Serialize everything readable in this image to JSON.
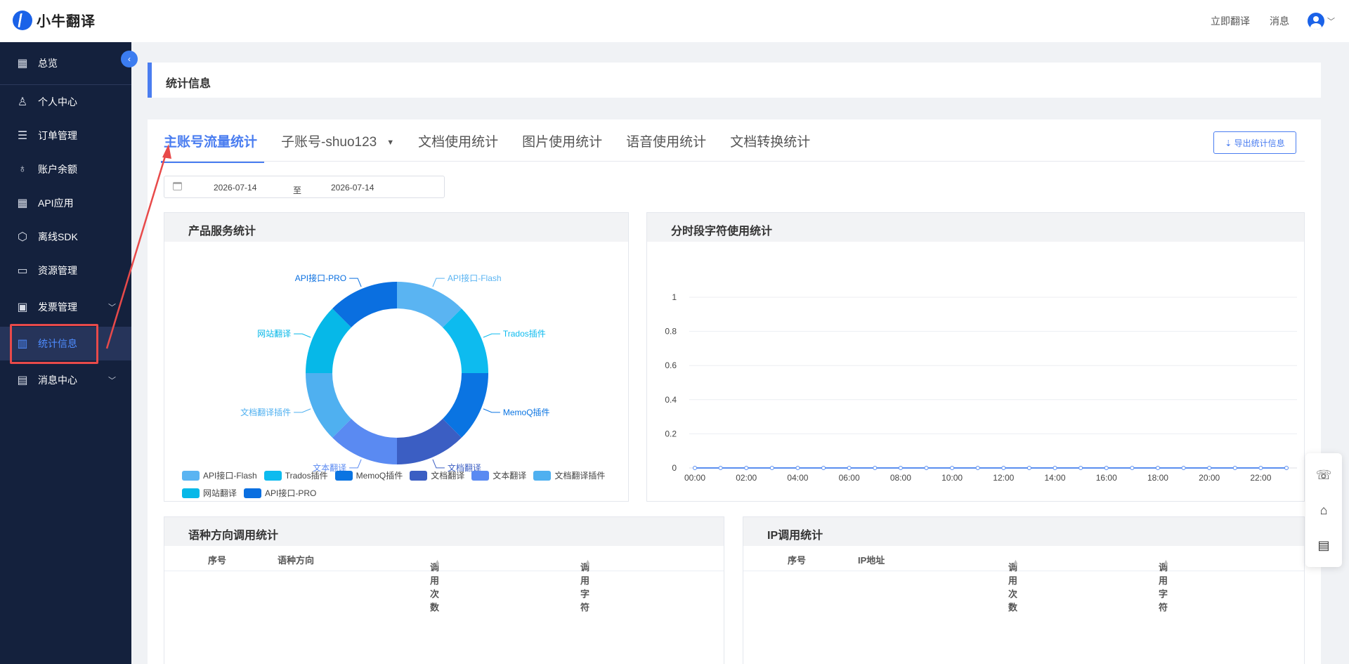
{
  "header": {
    "logo_text": "小牛翻译",
    "links": [
      "立即翻译",
      "消息"
    ],
    "avatar_caret": "﹀"
  },
  "sidebar": {
    "items": [
      {
        "label": "总览",
        "icon": "grid-icon",
        "glyph": "▦"
      },
      {
        "label": "个人中心",
        "icon": "user-icon",
        "glyph": "♙"
      },
      {
        "label": "订单管理",
        "icon": "order-icon",
        "glyph": "☰"
      },
      {
        "label": "账户余额",
        "icon": "wallet-icon",
        "glyph": "♁"
      },
      {
        "label": "API应用",
        "icon": "apps-icon",
        "glyph": "▦"
      },
      {
        "label": "离线SDK",
        "icon": "cube-icon",
        "glyph": "⬡"
      },
      {
        "label": "资源管理",
        "icon": "folder-icon",
        "glyph": "▭"
      },
      {
        "label": "发票管理",
        "icon": "invoice-icon",
        "glyph": "▣"
      },
      {
        "label": "统计信息",
        "icon": "chart-icon",
        "glyph": "▥"
      },
      {
        "label": "消息中心",
        "icon": "message-icon",
        "glyph": "▤"
      }
    ],
    "active_index": 8
  },
  "page": {
    "title": "统计信息"
  },
  "tabs": [
    {
      "label": "主账号流量统计"
    },
    {
      "label": "子账号-shuo123",
      "dropdown": true
    },
    {
      "label": "文档使用统计"
    },
    {
      "label": "图片使用统计"
    },
    {
      "label": "语音使用统计"
    },
    {
      "label": "文档转换统计"
    }
  ],
  "export_label": "⇣ 导出统计信息",
  "date_range": {
    "start": "2026-07-14",
    "separator": "至",
    "end": "2026-07-14"
  },
  "product_card": {
    "title": "产品服务统计"
  },
  "hourly_card": {
    "title": "分时段字符使用统计"
  },
  "lang_card": {
    "title": "语种方向调用统计",
    "columns": [
      "序号",
      "语种方向",
      "调用次数",
      "调用字符"
    ]
  },
  "ip_card": {
    "title": "IP调用统计",
    "columns": [
      "序号",
      "IP地址",
      "调用次数",
      "调用字符"
    ]
  },
  "colors": {
    "accent": "#4a7df0",
    "sidebar_bg": "#14213d",
    "highlight": "#e84a4a"
  },
  "chart_data": [
    {
      "type": "pie",
      "style": "donut",
      "labels": [
        "API接口-Flash",
        "Trados插件",
        "MemoQ插件",
        "文档翻译",
        "文本翻译",
        "文档翻译插件",
        "网站翻译",
        "API接口-PRO"
      ],
      "values": [
        1,
        1,
        1,
        1,
        1,
        1,
        1,
        1
      ],
      "colors": [
        "#5ab4f2",
        "#0dbbef",
        "#0a74e2",
        "#3b5ec3",
        "#5a8af2",
        "#4fb0f0",
        "#06b8e8",
        "#0a6fe0"
      ],
      "legend_position": "bottom"
    },
    {
      "type": "line",
      "x": [
        "00:00",
        "01:00",
        "02:00",
        "03:00",
        "04:00",
        "05:00",
        "06:00",
        "07:00",
        "08:00",
        "09:00",
        "10:00",
        "11:00",
        "12:00",
        "13:00",
        "14:00",
        "15:00",
        "16:00",
        "17:00",
        "18:00",
        "19:00",
        "20:00",
        "21:00",
        "22:00",
        "23:00"
      ],
      "x_tick_labels": [
        "00:00",
        "02:00",
        "04:00",
        "06:00",
        "08:00",
        "10:00",
        "12:00",
        "14:00",
        "16:00",
        "18:00",
        "20:00",
        "22:00"
      ],
      "series": [
        {
          "values": [
            0,
            0,
            0,
            0,
            0,
            0,
            0,
            0,
            0,
            0,
            0,
            0,
            0,
            0,
            0,
            0,
            0,
            0,
            0,
            0,
            0,
            0,
            0,
            0
          ]
        }
      ],
      "ylim": [
        0,
        1
      ],
      "y_ticks": [
        "0",
        "0.2",
        "0.4",
        "0.6",
        "0.8",
        "1"
      ],
      "grid": true,
      "line_color": "#5a8ef0"
    }
  ]
}
